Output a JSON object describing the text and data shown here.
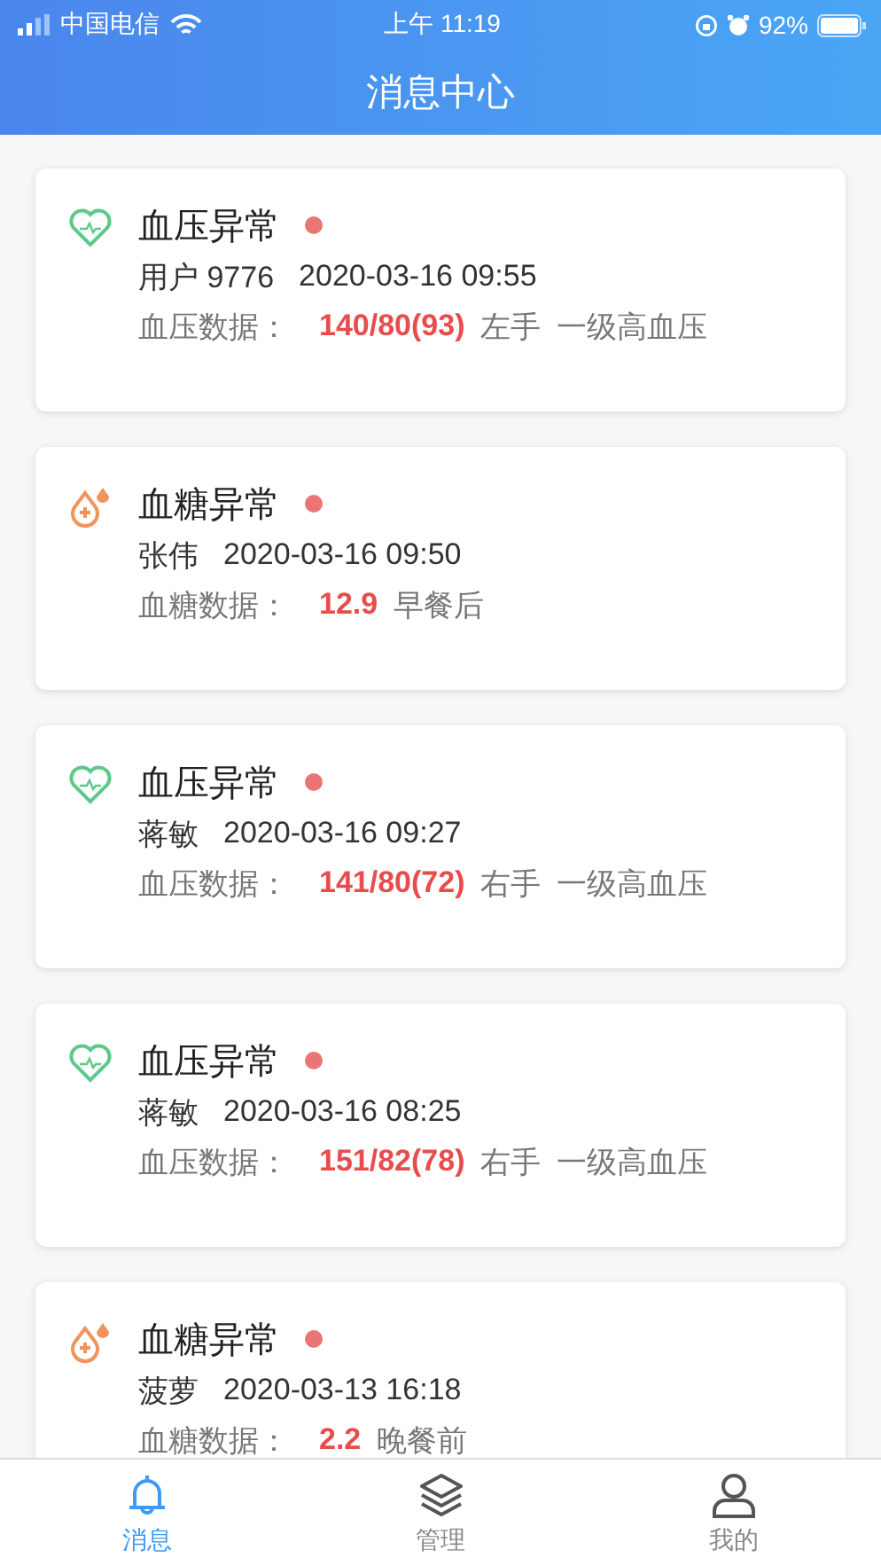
{
  "status_bar": {
    "carrier": "中国电信",
    "time": "上午 11:19",
    "battery": "92%"
  },
  "header": {
    "title": "消息中心"
  },
  "messages": [
    {
      "kind": "blood_pressure",
      "title": "血压异常",
      "unread": true,
      "user": "用户 9776",
      "time": "2020-03-16 09:55",
      "data_label": "血压数据：",
      "value": "140/80(93)",
      "notes": [
        "左手",
        "一级高血压"
      ]
    },
    {
      "kind": "blood_sugar",
      "title": "血糖异常",
      "unread": true,
      "user": "张伟",
      "time": "2020-03-16 09:50",
      "data_label": "血糖数据：",
      "value": "12.9",
      "notes": [
        "早餐后"
      ]
    },
    {
      "kind": "blood_pressure",
      "title": "血压异常",
      "unread": true,
      "user": "蒋敏",
      "time": "2020-03-16 09:27",
      "data_label": "血压数据：",
      "value": "141/80(72)",
      "notes": [
        "右手",
        "一级高血压"
      ]
    },
    {
      "kind": "blood_pressure",
      "title": "血压异常",
      "unread": true,
      "user": "蒋敏",
      "time": "2020-03-16 08:25",
      "data_label": "血压数据：",
      "value": "151/82(78)",
      "notes": [
        "右手",
        "一级高血压"
      ]
    },
    {
      "kind": "blood_sugar",
      "title": "血糖异常",
      "unread": true,
      "user": "菠萝",
      "time": "2020-03-13 16:18",
      "data_label": "血糖数据：",
      "value": "2.2",
      "notes": [
        "晚餐前"
      ]
    }
  ],
  "tab_bar": [
    {
      "kind": "bell",
      "label": "消息",
      "selected": true
    },
    {
      "kind": "layers",
      "label": "管理",
      "selected": false
    },
    {
      "kind": "person",
      "label": "我的",
      "selected": false
    }
  ]
}
